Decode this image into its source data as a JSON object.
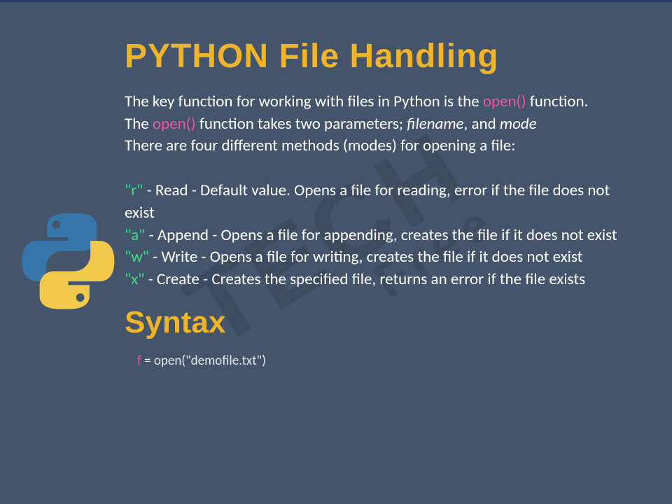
{
  "watermark": {
    "line1": "TECH",
    "line2": "Free"
  },
  "title": "PYTHON File Handling",
  "intro": {
    "seg1": "The key function for working with files in Python is the ",
    "open1": " open() ",
    "seg2": " function.",
    "seg3": "The ",
    "open2": "open()",
    "seg4": " function takes two parameters; ",
    "param1": "filename",
    "seg5": ", and ",
    "param2": "mode",
    "line4": "There are four different methods (modes) for opening a file:"
  },
  "modes": [
    {
      "flag": "\"r\"",
      "rest": " - Read - Default value. Opens a file for reading, error if the file does not exist"
    },
    {
      "flag": "\"a\"",
      "rest": " - Append - Opens a file for appending, creates the file if it does not exist"
    },
    {
      "flag": "\"w\"",
      "rest": " - Write - Opens a file for writing, creates the file if it does not exist"
    },
    {
      "flag": "\"x\"",
      "rest": " - Create - Creates the specified file, returns an error if the file exists"
    }
  ],
  "syntax_heading": "Syntax",
  "code": {
    "var": "f",
    "rest": " = open(\"demofile.txt\")"
  }
}
